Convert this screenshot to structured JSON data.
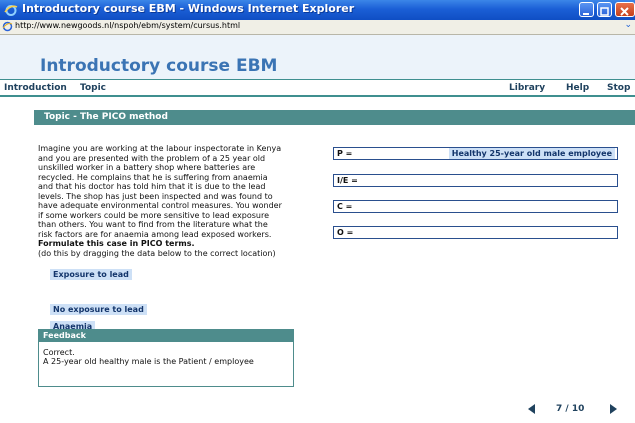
{
  "window": {
    "title": "Introductory course EBM - Windows Internet Explorer",
    "url": "http://www.newgoods.nl/nspoh/ebm/system/cursus.html"
  },
  "app": {
    "title": "Introductory course EBM"
  },
  "nav": {
    "introduction": "Introduction",
    "topic": "Topic",
    "library": "Library",
    "help": "Help",
    "stop": "Stop"
  },
  "topic": {
    "heading": "Topic - The PICO method"
  },
  "scenario": {
    "lines": [
      "Imagine you are working at the labour inspectorate in Kenya",
      "and you are presented with the problem of a 25 year old",
      "unskilled worker in a battery shop where batteries are",
      "recycled. He complains that he is suffering from anaemia",
      "and that his doctor has told him that it is due to the lead",
      "levels. The shop has just been inspected and was found to",
      "have adequate environmental control measures. You wonder",
      "if some workers could be more sensitive to lead exposure",
      "than others. You want to find from the literature what the",
      "risk factors are for anaemia among lead exposed workers."
    ],
    "instruction_bold": "Formulate this case in PICO terms.",
    "instruction": "(do this by dragging the data below to the correct location)"
  },
  "draggables": {
    "exposure": "Exposure to lead",
    "no_exposure": "No exposure to lead",
    "anaemia": "Anaemia"
  },
  "pico": {
    "p_label": "P =",
    "p_value": "Healthy 25-year old male employee",
    "i_label": "I/E =",
    "c_label": "C =",
    "o_label": "O ="
  },
  "feedback": {
    "title": "Feedback",
    "line1": "Correct.",
    "line2": "A 25-year old healthy male is the Patient / employee"
  },
  "pager": {
    "text": "7 / 10"
  },
  "colors": {
    "accent": "#4e8c8c",
    "title": "#3b74b4",
    "chip": "#cde0f6"
  }
}
